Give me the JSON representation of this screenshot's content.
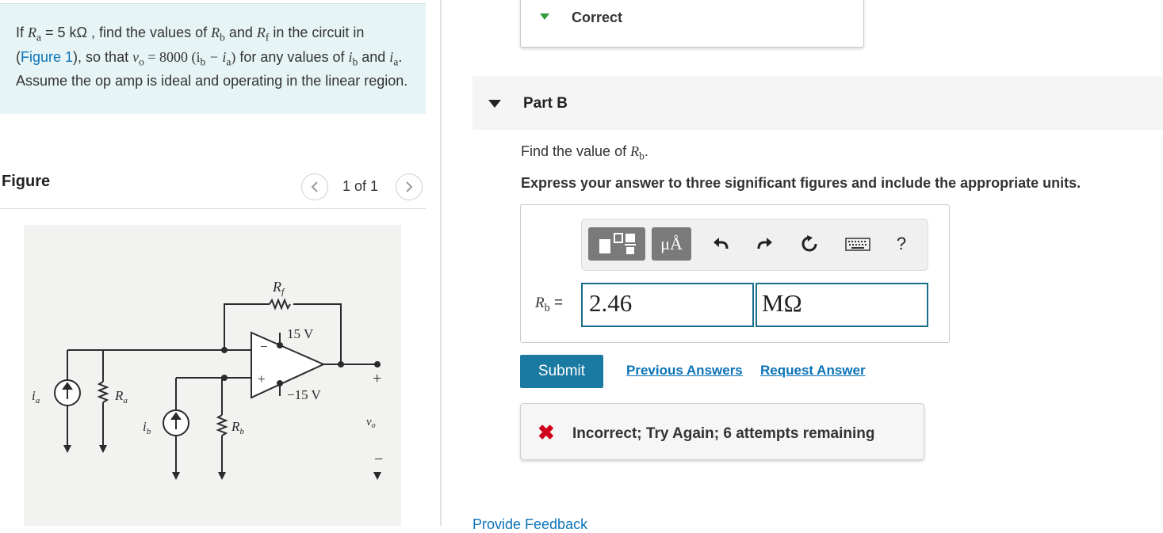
{
  "problem": {
    "p1": "If ",
    "ra_sym": "R",
    "ra_sub": "a",
    "p2": " = 5  kΩ , find the values of ",
    "rb_sym": "R",
    "rb_sub": "b",
    "p3": " and ",
    "rf_sym": "R",
    "rf_sub": "f",
    "p4": " in the circuit in (",
    "figure_link": "Figure 1",
    "p5": "), so that ",
    "eq_vo": "v",
    "eq_vo_sub": "o",
    "eq_rest": " = 8000 (i",
    "eq_ib_sub": "b",
    "eq_minus": "  −  i",
    "eq_ia_sub": "a",
    "eq_close": ")",
    "p6": " for any values of ",
    "ib_sym": "i",
    "ib_sub": "b",
    "p7": " and ",
    "ia_sym": "i",
    "ia_sub": "a",
    "p8": ". Assume the op amp is ideal and operating in the linear region."
  },
  "figure": {
    "title": "Figure",
    "counter": "1 of 1",
    "prev_icon": "chevron-left-icon",
    "next_icon": "chevron-right-icon",
    "labels": {
      "rf": "R",
      "rf_sub": "f",
      "ra": "R",
      "ra_sub": "a",
      "rb": "R",
      "rb_sub": "b",
      "ia": "i",
      "ia_sub": "a",
      "ib": "i",
      "ib_sub": "b",
      "vpos": "15 V",
      "vneg": "−15 V",
      "vo": "v",
      "vo_sub": "o",
      "plus": "+",
      "minus": "−"
    }
  },
  "previous_part": {
    "status": "Correct",
    "icon": "triangle-down-icon",
    "color": "#2e9c39"
  },
  "part_b": {
    "title": "Part B",
    "question_prefix": "Find the value of ",
    "question_sym": "R",
    "question_sub": "b",
    "question_suffix": ".",
    "instruction": "Express your answer to three significant figures and include the appropriate units."
  },
  "toolbar": {
    "template_icon": "fraction-template-icon",
    "units_label": "μÅ",
    "undo_icon": "undo-icon",
    "redo_icon": "redo-icon",
    "reset_icon": "reset-icon",
    "keyboard_icon": "keyboard-icon",
    "help_label": "?"
  },
  "answer": {
    "label_sym": "R",
    "label_sub": "b",
    "label_eq": " =",
    "value": "2.46",
    "unit": "MΩ"
  },
  "actions": {
    "submit": "Submit",
    "previous_answers": "Previous Answers",
    "request_answer": "Request Answer"
  },
  "feedback": {
    "icon": "✖",
    "message": "Incorrect; Try Again; 6 attempts remaining",
    "color": "#d0021b"
  },
  "footer": {
    "provide_feedback": "Provide Feedback"
  }
}
